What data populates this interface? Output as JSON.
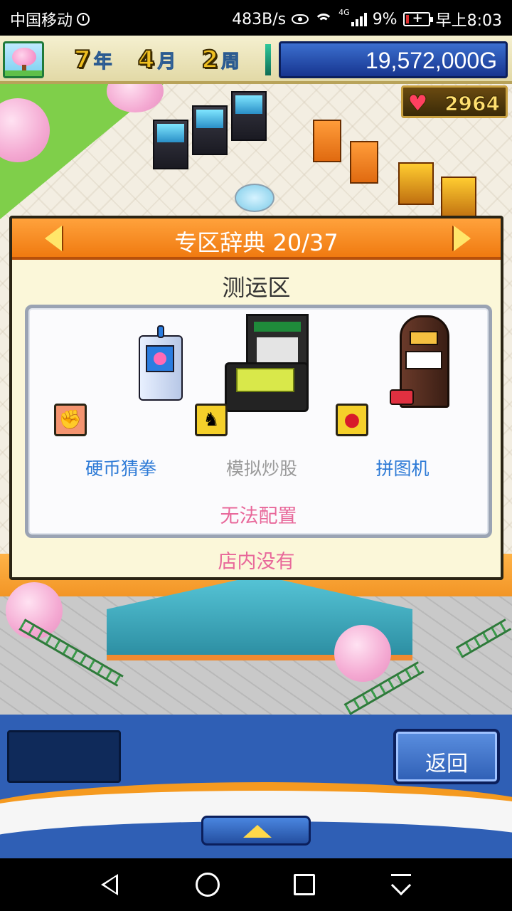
{
  "status_bar": {
    "carrier": "中国移动",
    "net_speed": "483B/s",
    "network_type": "4G",
    "battery": "9%",
    "time": "早上8:03"
  },
  "top_bar": {
    "year": "7",
    "year_unit": "年",
    "month": "4",
    "month_unit": "月",
    "week": "2",
    "week_unit": "周",
    "money": "19,572,000G"
  },
  "scene": {
    "heart_points": "2964"
  },
  "dialog": {
    "title": "专区辞典 20/37",
    "zone_name": "测运区",
    "items": [
      {
        "label": "硬币猜拳",
        "state": "available",
        "badge_icon": "rock-paper-scissors-icon"
      },
      {
        "label": "模拟炒股",
        "state": "unavailable",
        "badge_icon": "horse-icon"
      },
      {
        "label": "拼图机",
        "state": "available",
        "badge_icon": "cherry-icon"
      }
    ],
    "cannot_place_notice": "无法配置",
    "not_in_store_notice": "店内没有"
  },
  "bottom_bar": {
    "back_label": "返回"
  },
  "colors": {
    "dialog_header": "#f07a10",
    "item_available": "#2d7ad6",
    "item_unavailable": "#9a9a9a",
    "notice": "#e8689a",
    "bottom_bar": "#2f5fb5"
  }
}
